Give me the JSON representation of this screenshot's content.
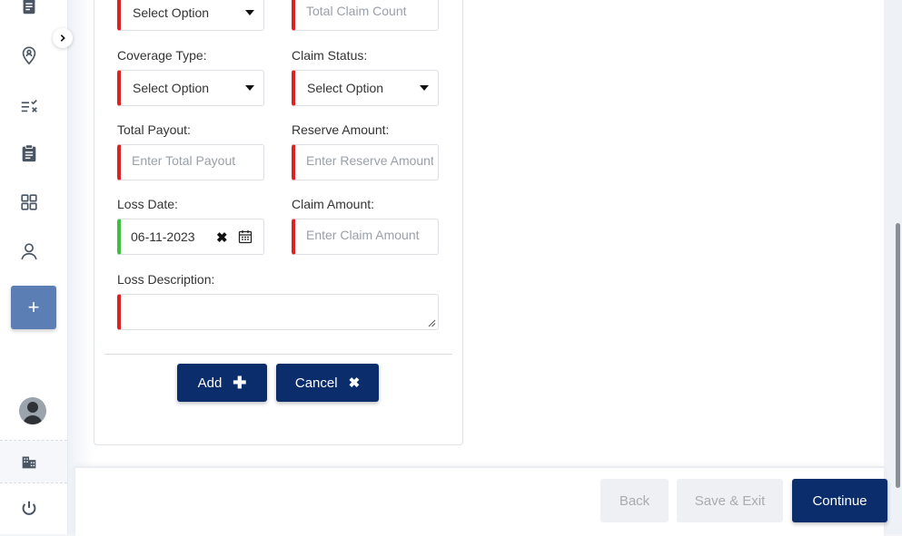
{
  "form": {
    "row1": {
      "left_select_value": "Select Option",
      "right_placeholder": "Total Claim Count"
    },
    "coverage_type": {
      "label": "Coverage Type:",
      "value": "Select Option"
    },
    "claim_status": {
      "label": "Claim Status:",
      "value": "Select Option"
    },
    "total_payout": {
      "label": "Total Payout:",
      "placeholder": "Enter Total Payout"
    },
    "reserve_amount": {
      "label": "Reserve Amount:",
      "placeholder": "Enter Reserve Amount"
    },
    "loss_date": {
      "label": "Loss Date:",
      "value": "06-11-2023"
    },
    "claim_amount": {
      "label": "Claim Amount:",
      "placeholder": "Enter Claim Amount"
    },
    "loss_description": {
      "label": "Loss Description:",
      "value": ""
    },
    "add_label": "Add",
    "cancel_label": "Cancel"
  },
  "footer": {
    "back_label": "Back",
    "save_exit_label": "Save & Exit",
    "continue_label": "Continue"
  },
  "sidebar": {
    "icons": [
      "document-icon",
      "location-user-icon",
      "checklist-icon",
      "clipboard-icon",
      "grid-icon",
      "user-icon"
    ],
    "add_symbol": "+",
    "bottom_icons": [
      "building-icon",
      "power-icon"
    ]
  },
  "colors": {
    "primary": "#0c2d6b",
    "required": "#e02020",
    "valid": "#3cc13c",
    "add_tile": "#5b7fb4"
  }
}
